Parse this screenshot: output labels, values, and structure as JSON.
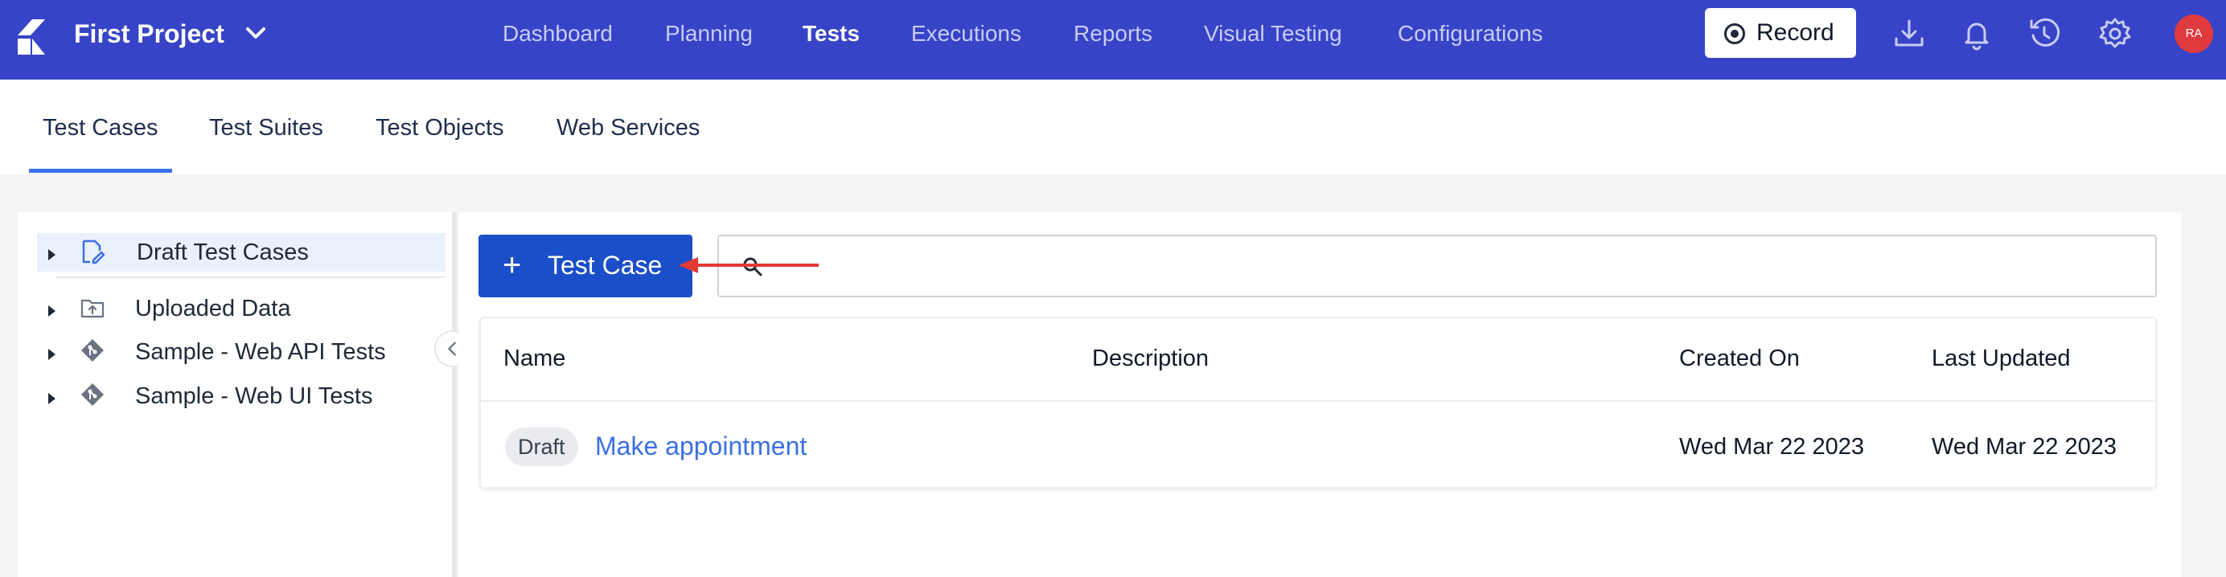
{
  "topbar": {
    "project_name": "First Project",
    "nav": [
      "Dashboard",
      "Planning",
      "Tests",
      "Executions",
      "Reports",
      "Visual Testing",
      "Configurations"
    ],
    "active_nav": "Tests",
    "record_label": "Record",
    "avatar_initials": "RA",
    "icons": [
      "download-icon",
      "bell-icon",
      "history-icon",
      "gear-icon"
    ]
  },
  "subtabs": [
    "Test Cases",
    "Test Suites",
    "Test Objects",
    "Web Services"
  ],
  "active_subtab": "Test Cases",
  "tree": {
    "items": [
      {
        "label": "Draft Test Cases",
        "icon": "draft-edit-icon",
        "selected": true
      },
      {
        "label": "Uploaded Data",
        "icon": "folder-upload-icon",
        "selected": false
      },
      {
        "label": "Sample - Web API Tests",
        "icon": "git-diamond-icon",
        "selected": false
      },
      {
        "label": "Sample - Web UI Tests",
        "icon": "git-diamond-icon",
        "selected": false
      }
    ]
  },
  "main": {
    "add_button_label": "Test Case",
    "table": {
      "headers": [
        "Name",
        "Description",
        "Created On",
        "Last Updated"
      ],
      "rows": [
        {
          "badge": "Draft",
          "name": "Make appointment",
          "description": "",
          "created_on": "Wed Mar 22 2023",
          "last_updated": "Wed Mar 22 2023"
        }
      ]
    }
  },
  "colors": {
    "topbar": "#3744c7",
    "primary_button": "#1b4ec9",
    "link": "#3b6fe3",
    "annotation_arrow": "#e53935",
    "avatar": "#e0393e"
  }
}
